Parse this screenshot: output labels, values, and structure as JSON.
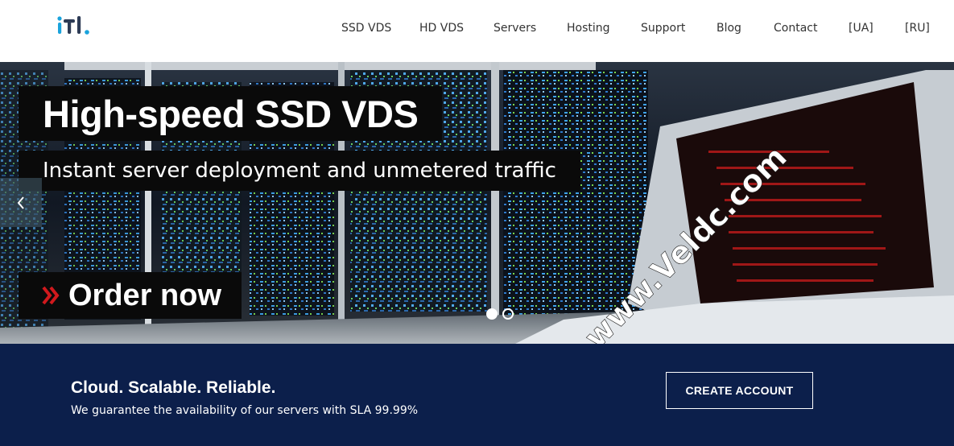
{
  "header": {
    "logo_icon": "itl-logo",
    "nav": [
      {
        "label": "SSD VDS"
      },
      {
        "label": "HD VDS"
      },
      {
        "label": "Servers"
      },
      {
        "label": "Hosting"
      },
      {
        "label": "Support"
      },
      {
        "label": "Blog"
      },
      {
        "label": "Contact"
      },
      {
        "label": "[UA]"
      },
      {
        "label": "[RU]"
      }
    ]
  },
  "hero": {
    "title": "High-speed SSD VDS",
    "subtitle": "Instant server deployment and unmetered traffic",
    "order_label": "Order now",
    "prev_icon": "chevron-left-icon",
    "slides_total": 2,
    "active_slide": 1,
    "watermark": "www.Veldc.com"
  },
  "band": {
    "heading": "Cloud. Scalable. Reliable.",
    "subtext": "We guarantee the availability of our servers with SLA 99.99%",
    "cta_label": "CREATE ACCOUNT"
  },
  "colors": {
    "band_bg": "#0c1f4b",
    "accent_red": "#d0191d",
    "logo_blue": "#1aa3dc",
    "logo_dark": "#2d3b55"
  }
}
